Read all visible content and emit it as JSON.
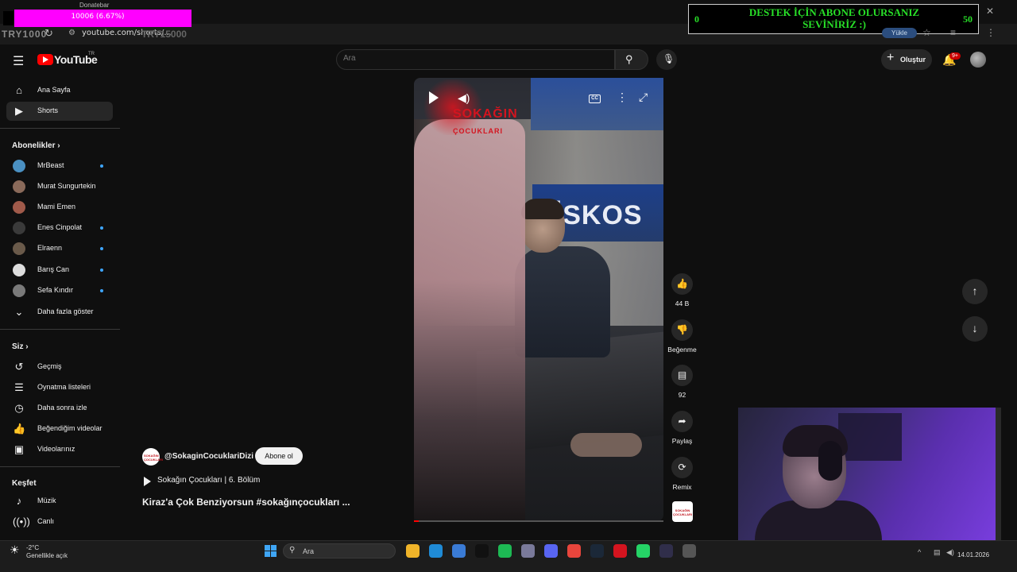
{
  "browser": {
    "donation_title": "Donatebar",
    "donation_progress": "10006 (6.67%)",
    "donation_fraction": 0.0667,
    "try_left": "TRY1000",
    "try_right": "TRY15000",
    "url": "youtube.com/shorts/...",
    "yukle_label": "Yükle"
  },
  "banner": {
    "left_value": "0",
    "right_value": "50",
    "text": "DESTEK İÇİN ABONE OLURSANIZ SEVİNİRİZ :)"
  },
  "header": {
    "logo_text": "YouTube",
    "logo_region": "TR",
    "search_placeholder": "Ara",
    "create_label": "Oluştur",
    "notification_badge": "9+"
  },
  "sidebar": {
    "main": [
      {
        "label": "Ana Sayfa",
        "icon": "home-icon"
      },
      {
        "label": "Shorts",
        "icon": "shorts-icon",
        "active": true
      }
    ],
    "subscriptions_heading": "Abonelikler",
    "subscriptions": [
      {
        "label": "MrBeast",
        "dot": true,
        "color": "#4a90c2"
      },
      {
        "label": "Murat Sungurtekin",
        "dot": false,
        "color": "#8a6a5a"
      },
      {
        "label": "Mami Emen",
        "dot": false,
        "color": "#a05a4a"
      },
      {
        "label": "Enes Cinpolat",
        "dot": true,
        "color": "#3a3a3a"
      },
      {
        "label": "Elraenn",
        "dot": true,
        "color": "#6a5a4a"
      },
      {
        "label": "Barış Can",
        "dot": true,
        "color": "#dddddd"
      },
      {
        "label": "Sefa Kındır",
        "dot": true,
        "color": "#7a7a7a"
      }
    ],
    "show_more": "Daha fazla göster",
    "you_heading": "Siz",
    "you_items": [
      {
        "label": "Geçmiş",
        "icon": "history-icon"
      },
      {
        "label": "Oynatma listeleri",
        "icon": "playlists-icon"
      },
      {
        "label": "Daha sonra izle",
        "icon": "watch-later-icon"
      },
      {
        "label": "Beğendiğim videolar",
        "icon": "liked-icon"
      },
      {
        "label": "Videolarınız",
        "icon": "your-videos-icon"
      }
    ],
    "explore_heading": "Keşfet",
    "explore_items": [
      {
        "label": "Müzik",
        "icon": "music-icon"
      },
      {
        "label": "Canlı",
        "icon": "live-icon"
      }
    ]
  },
  "video": {
    "overlay_title": "SOKAĞIN",
    "overlay_subtitle": "ÇOCUKLARI",
    "sign_text": "FİSKOS",
    "channel_avatar_text": "SOKAĞIN ÇOCUKLARI",
    "channel": "@SokaginCocuklariDizi",
    "subscribe_label": "Abone ol",
    "playlist_label": "Sokağın Çocukları | 6. Bölüm",
    "title": "Kiraz'a Çok Benziyorsun #sokağınçocukları ...",
    "progress": 0.02
  },
  "actions": {
    "likes": "44 B",
    "dislike": "Beğenme",
    "comments": "92",
    "share": "Paylaş",
    "remix": "Remix"
  },
  "taskbar": {
    "weather_temp": "-2°C",
    "weather_desc": "Genellikle açık",
    "search": "Ara",
    "date": "14.01.2026",
    "apps": [
      {
        "name": "file-explorer-icon",
        "color": "#f0b429"
      },
      {
        "name": "edge-icon",
        "color": "#1f8bd6"
      },
      {
        "name": "store-icon",
        "color": "#3a7bd5"
      },
      {
        "name": "tiktok-icon",
        "color": "#111111"
      },
      {
        "name": "spotify-icon",
        "color": "#1db954"
      },
      {
        "name": "app-icon",
        "color": "#7a7a9a"
      },
      {
        "name": "discord-icon",
        "color": "#5865f2"
      },
      {
        "name": "chrome-icon",
        "color": "#e8453c"
      },
      {
        "name": "steam-icon",
        "color": "#1b2838"
      },
      {
        "name": "app-red-icon",
        "color": "#d4141f"
      },
      {
        "name": "whatsapp-icon",
        "color": "#25d366"
      },
      {
        "name": "obs-icon",
        "color": "#302e4a"
      },
      {
        "name": "settings-icon",
        "color": "#555555"
      }
    ]
  }
}
